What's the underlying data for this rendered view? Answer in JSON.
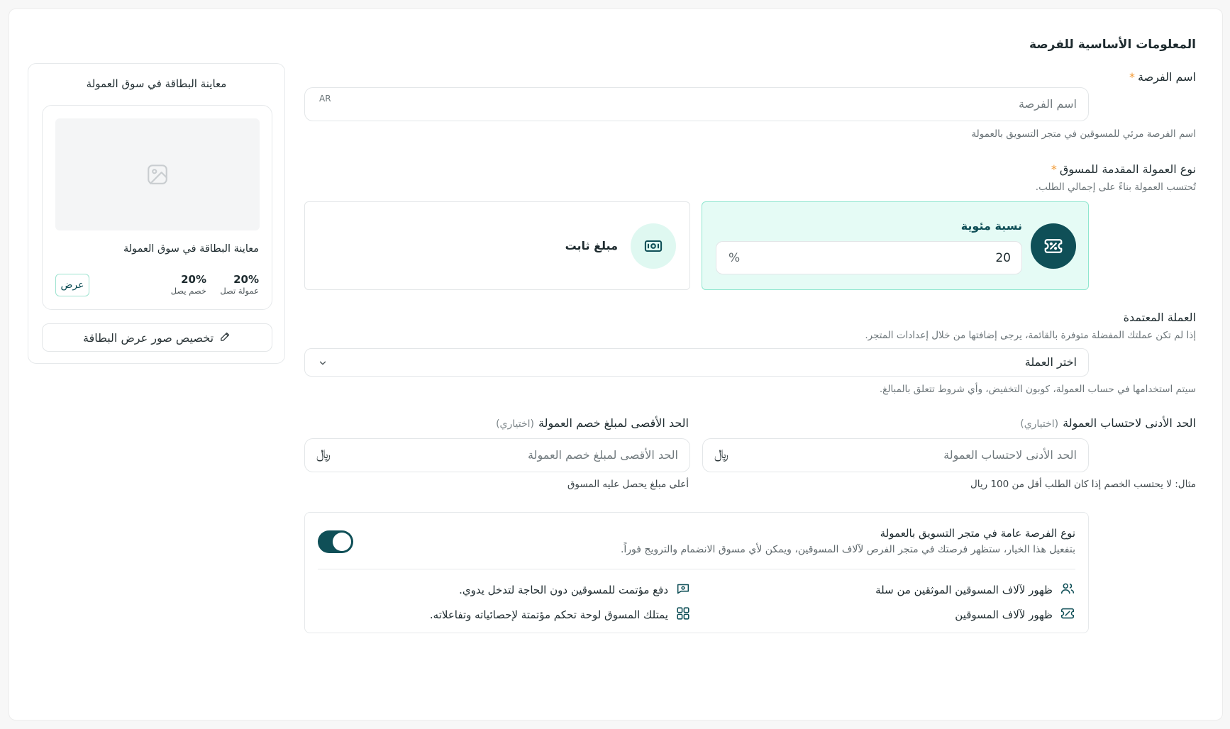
{
  "section": {
    "title": "المعلومات الأساسية للفرصة"
  },
  "name_field": {
    "label": "اسم الفرصة",
    "required_mark": "*",
    "placeholder": "اسم الفرصة",
    "lang_badge": "AR",
    "hint": "اسم الفرصة مرئي للمسوقين في متجر التسويق بالعمولة"
  },
  "commission_type": {
    "label": "نوع العمولة المقدمة للمسوق",
    "required_mark": "*",
    "hint": "تُحتسب العمولة بناءً على إجمالي الطلب.",
    "percentage": {
      "label": "نسبة مئوية",
      "value": "20",
      "suffix": "%",
      "selected": true
    },
    "fixed": {
      "label": "مبلغ ثابت",
      "selected": false
    }
  },
  "currency": {
    "label": "العملة المعتمدة",
    "hint": "إذا لم تكن عملتك المفضلة متوفرة بالقائمة، يرجى إضافتها من خلال إعدادات المتجر.",
    "placeholder": "اختر العملة",
    "note": "سيتم استخدامها في حساب العمولة، كوبون التخفيض، وأي شروط تتعلق بالمبالغ."
  },
  "min_commission": {
    "label": "الحد الأدنى لاحتساب العمولة",
    "optional": "(اختياري)",
    "placeholder": "الحد الأدنى لاحتساب العمولة",
    "currency_symbol": "﷼",
    "hint": "مثال: لا يحتسب الخصم إذا كان الطلب أقل من 100 ريال"
  },
  "max_commission": {
    "label": "الحد الأقصى لمبلغ خصم العمولة",
    "optional": "(اختياري)",
    "placeholder": "الحد الأقصى لمبلغ خصم العمولة",
    "currency_symbol": "﷼",
    "hint": "أعلى مبلغ يحصل عليه المسوق"
  },
  "public_opportunity": {
    "title": "نوع الفرصة عامة في متجر التسويق بالعمولة",
    "description": "بتفعيل هذا الخيار، ستظهر فرصتك في متجر الفرص لآلاف المسوقين، ويمكن لأي مسوق الانضمام والترويج فوراً.",
    "enabled": true,
    "features": [
      {
        "icon": "users-icon",
        "text": "ظهور لآلاف المسوقين الموثقين من سلة"
      },
      {
        "icon": "payment-icon",
        "text": "دفع مؤتمت للمسوقين دون الحاجة لتدخل يدوي."
      },
      {
        "icon": "ticket-percent-icon",
        "text": "ظهور لآلاف المسوقين"
      },
      {
        "icon": "dashboard-icon",
        "text": "يمتلك المسوق لوحة تحكم مؤتمتة لإحصائياته وتفاعلاته."
      }
    ]
  },
  "preview": {
    "title": "معاينة البطاقة في سوق العمولة",
    "card_title": "معاينة البطاقة في سوق العمولة",
    "commission_value": "20%",
    "commission_label": "عمولة تصل",
    "discount_value": "20%",
    "discount_label": "خصم يصل",
    "view_button": "عرض",
    "customize_button": "تخصيص صور عرض البطاقة"
  },
  "colors": {
    "primary": "#0f4f57",
    "accent_bg": "#e5fbf5",
    "accent_border": "#8fe6cf",
    "required": "#f39c38"
  }
}
